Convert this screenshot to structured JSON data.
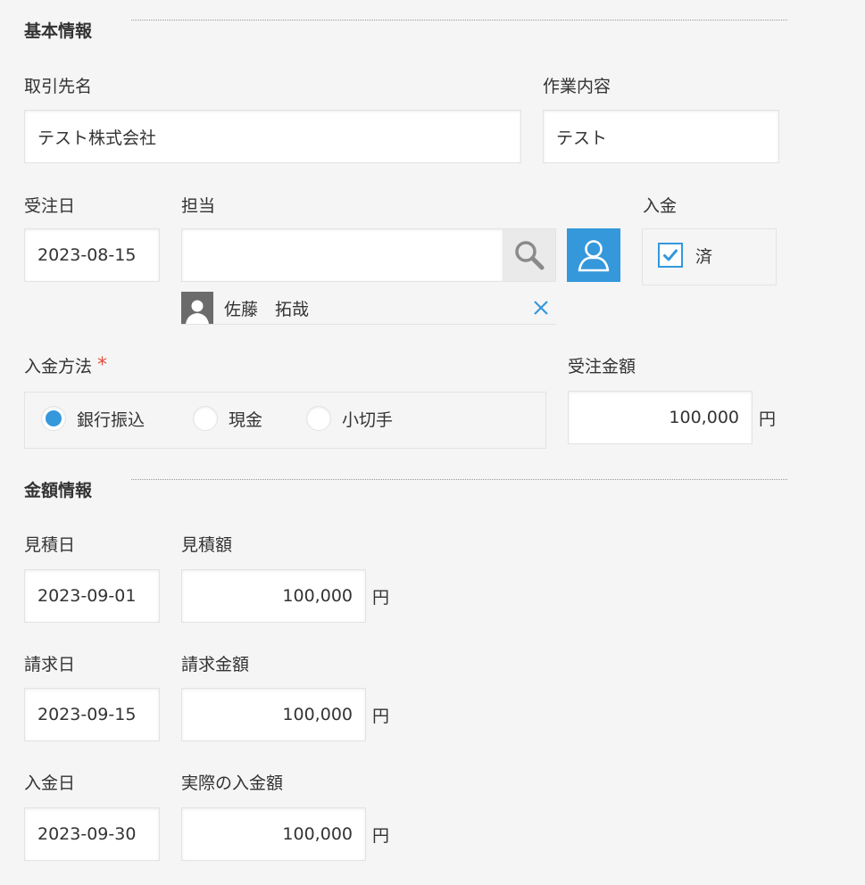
{
  "basic_section": {
    "title": "基本情報"
  },
  "fields": {
    "client_name": {
      "label": "取引先名",
      "value": "テスト株式会社"
    },
    "work_content": {
      "label": "作業内容",
      "value": "テスト"
    },
    "order_date": {
      "label": "受注日",
      "value": "2023-08-15"
    },
    "assignee": {
      "label": "担当",
      "value": "",
      "selected_user": "佐藤　拓哉"
    },
    "payment_status": {
      "label": "入金",
      "option": "済",
      "checked": true
    },
    "payment_method": {
      "label": "入金方法",
      "required_mark": "*",
      "options": [
        "銀行振込",
        "現金",
        "小切手"
      ],
      "selected": "銀行振込"
    },
    "order_amount": {
      "label": "受注金額",
      "value": "100,000",
      "unit": "円"
    }
  },
  "amount_section": {
    "title": "金額情報"
  },
  "amount_fields": {
    "estimate_date": {
      "label": "見積日",
      "value": "2023-09-01"
    },
    "estimate_amount": {
      "label": "見積額",
      "value": "100,000",
      "unit": "円"
    },
    "invoice_date": {
      "label": "請求日",
      "value": "2023-09-15"
    },
    "invoice_amount": {
      "label": "請求金額",
      "value": "100,000",
      "unit": "円"
    },
    "payment_date": {
      "label": "入金日",
      "value": "2023-09-30"
    },
    "actual_payment_amount": {
      "label": "実際の入金額",
      "value": "100,000",
      "unit": "円"
    }
  },
  "icons": {
    "search": "search-icon",
    "user": "user-icon",
    "check": "check-icon",
    "close": "close-icon"
  },
  "colors": {
    "accent": "#3498db",
    "required": "#e74c3c",
    "background": "#f5f5f5"
  }
}
